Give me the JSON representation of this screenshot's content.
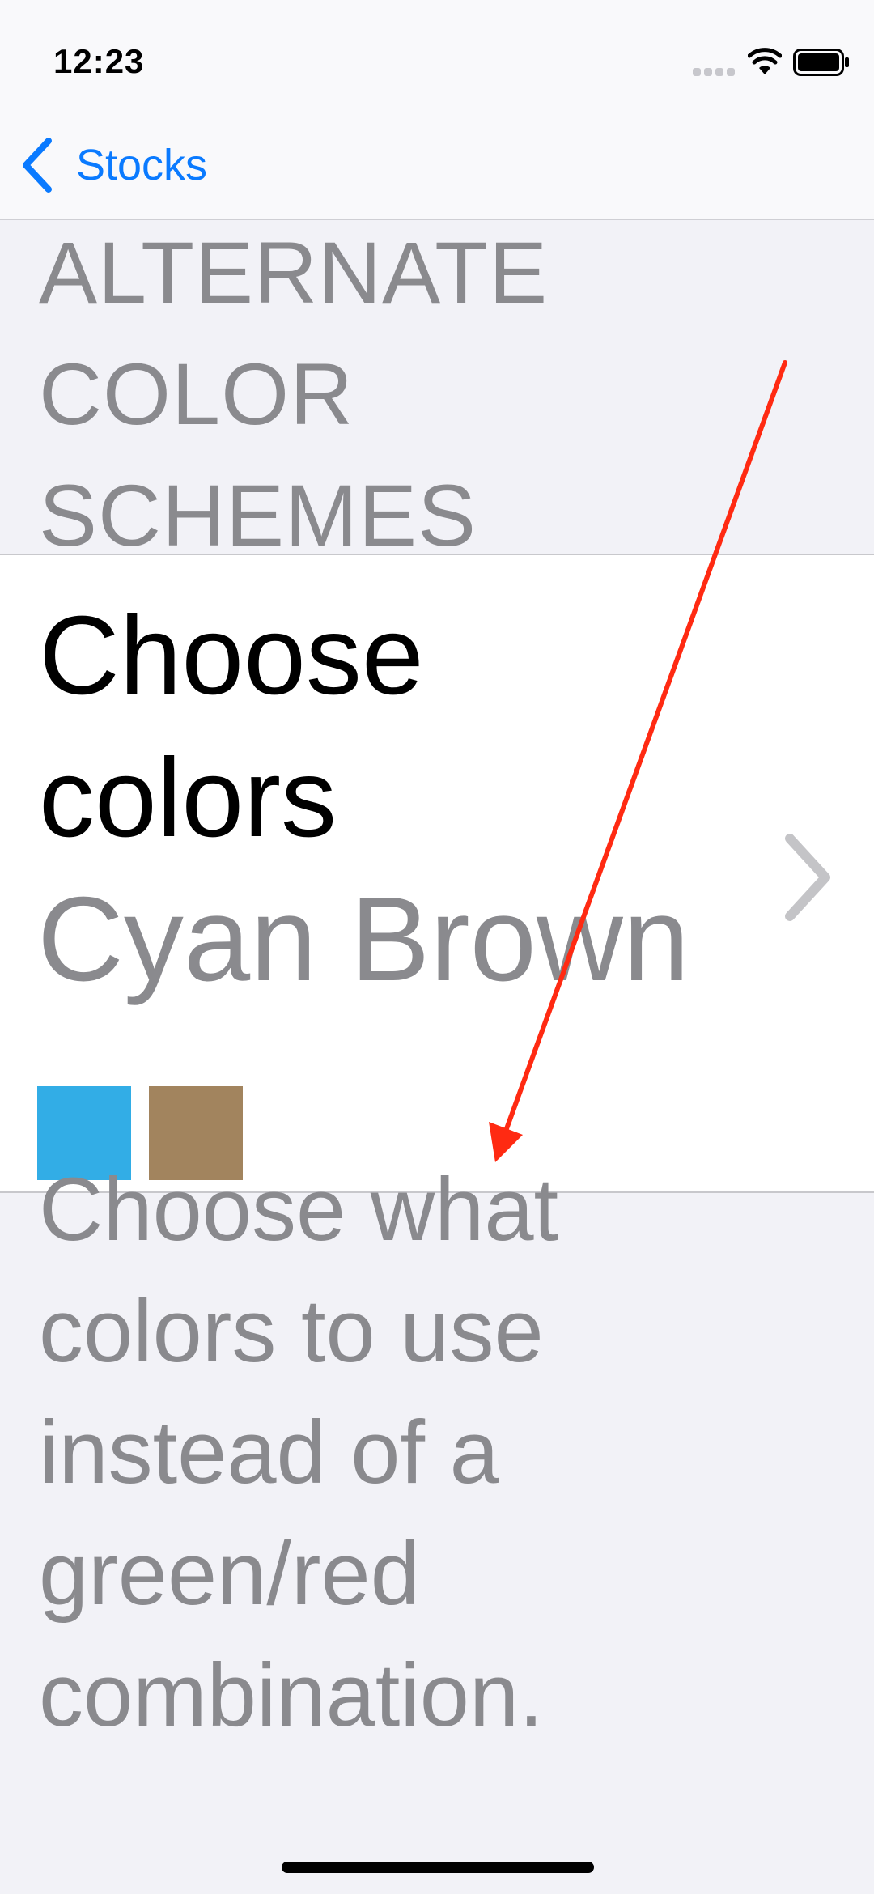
{
  "status_bar": {
    "time": "12:23"
  },
  "nav": {
    "back_label": "Stocks",
    "back_icon": "chevron-left-icon"
  },
  "section": {
    "header_lines": [
      "ALTERNATE",
      "COLOR",
      "SCHEMES"
    ]
  },
  "cell": {
    "title_lines": [
      "Choose",
      "colors"
    ],
    "subtitle": "Cyan Brown",
    "disclosure_icon": "chevron-right-icon",
    "swatches": [
      {
        "name": "Cyan",
        "color": "#32ade6"
      },
      {
        "name": "Brown",
        "color": "#a2845e"
      }
    ]
  },
  "footer": {
    "lines": [
      "Choose what",
      "colors to use",
      "instead of a",
      "green/red",
      "combination."
    ]
  },
  "colors": {
    "accent": "#0a7aff",
    "secondary_text": "#8a8a8e",
    "annotation": "#ff2a12"
  }
}
